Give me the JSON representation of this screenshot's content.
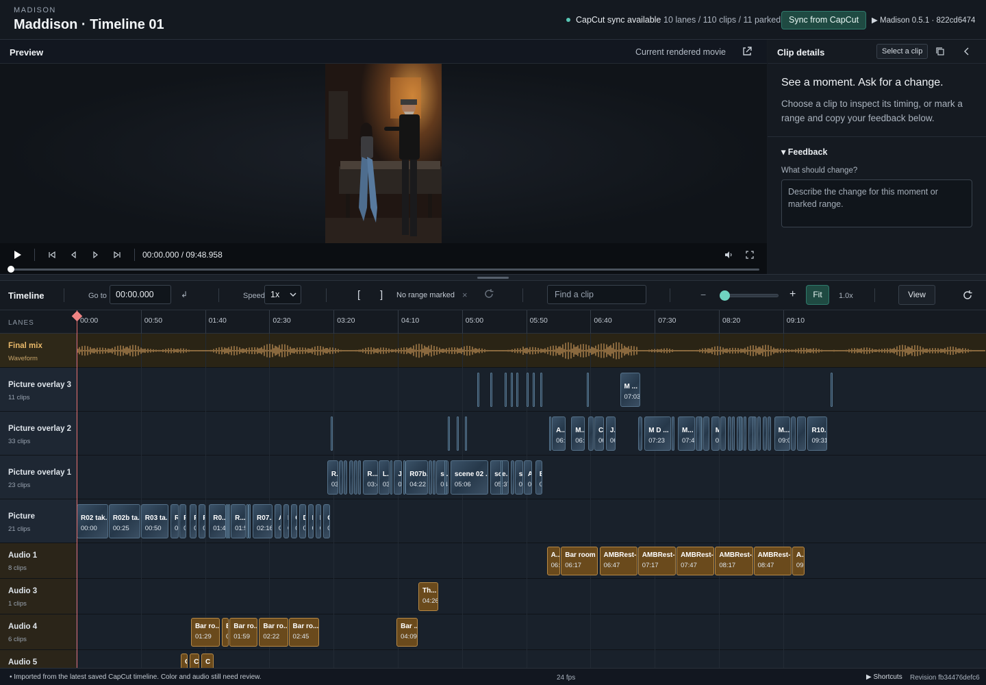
{
  "header": {
    "brand": "MADISON",
    "title": "Maddison · Timeline 01",
    "sync_status": "CapCut sync available",
    "counts": "10 lanes / 110 clips / 11 parked",
    "sync_button": "Sync from CapCut",
    "version": "▶ Madison 0.5.1 · 822cd6474",
    "accent_color": "#2f7a6c"
  },
  "preview": {
    "title": "Preview",
    "caption": "Current rendered movie",
    "icons": [
      "open-external-icon",
      "play-icon",
      "skip-start-icon",
      "frame-back-icon",
      "frame-forward-icon",
      "skip-end-icon",
      "volume-icon",
      "fullscreen-icon"
    ],
    "time": "00:00.000 / 09:48.958",
    "progress": 0
  },
  "details": {
    "title": "Clip details",
    "select_button": "Select a clip",
    "lead": "See a moment. Ask for a change.",
    "description": "Choose a clip to inspect its timing, or mark a range and copy your feedback below.",
    "feedback_toggle": "▾ Feedback",
    "feedback_question": "What should change?",
    "feedback_placeholder": "Describe the change for this moment or marked range."
  },
  "toolbar": {
    "title": "Timeline",
    "goto_label": "Go to",
    "goto_value": "00:00.000",
    "goto_enter": "↲",
    "speed_label": "Speed",
    "speed_value": "1x",
    "mark_in": "[",
    "mark_out": "]",
    "range_status": "No range marked",
    "clear": "×",
    "find_placeholder": "Find a clip",
    "zoom_out": "−",
    "zoom_in": "+",
    "zoom_slider": 0,
    "fit": "Fit",
    "zoom_level": "1.0x",
    "view": "View"
  },
  "ruler": {
    "lanes_label": "LANES",
    "ticks": [
      "00:00",
      "00:50",
      "01:40",
      "02:30",
      "03:20",
      "04:10",
      "05:00",
      "05:50",
      "06:40",
      "07:30",
      "08:20",
      "09:10"
    ]
  },
  "lanes": [
    {
      "name": "Final mix",
      "sub": "Waveform",
      "kind": "mix",
      "clips": []
    },
    {
      "name": "Picture overlay 3",
      "sub": "11 clips",
      "kind": "pic",
      "clips": [
        {
          "s": 312,
          "d": 1
        },
        {
          "s": 322,
          "d": 1
        },
        {
          "s": 333,
          "d": 1
        },
        {
          "s": 338,
          "d": 2
        },
        {
          "s": 342,
          "d": 1
        },
        {
          "s": 350,
          "d": 1
        },
        {
          "s": 355,
          "d": 1
        },
        {
          "s": 361,
          "d": 1
        },
        {
          "s": 397,
          "d": 2
        },
        {
          "name": "M ...",
          "time": "07:03",
          "s": 423,
          "d": 16
        },
        {
          "s": 587,
          "d": 1
        }
      ]
    },
    {
      "name": "Picture overlay 2",
      "sub": "33 clips",
      "kind": "pic",
      "clips": [
        {
          "s": 198,
          "d": 1
        },
        {
          "s": 289,
          "d": 1
        },
        {
          "s": 296,
          "d": 1
        },
        {
          "s": 302,
          "d": 2
        },
        {
          "s": 368,
          "d": 2
        },
        {
          "name": "A...",
          "time": "06:0",
          "s": 370,
          "d": 11
        },
        {
          "name": "M...",
          "time": "06:2",
          "s": 385,
          "d": 11
        },
        {
          "s": 398,
          "d": 5
        },
        {
          "name": "C...",
          "time": "06",
          "s": 403,
          "d": 8
        },
        {
          "name": "J...",
          "time": "06:",
          "s": 412,
          "d": 8
        },
        {
          "s": 437,
          "d": 4
        },
        {
          "name": "M D ...",
          "time": "07:23",
          "s": 442,
          "d": 21
        },
        {
          "s": 463,
          "d": 3
        },
        {
          "name": "M...",
          "time": "07:48",
          "s": 468,
          "d": 14
        },
        {
          "s": 482,
          "d": 6
        },
        {
          "s": 488,
          "d": 5
        },
        {
          "name": "M...",
          "time": "08",
          "s": 494,
          "d": 7
        },
        {
          "s": 501,
          "d": 5
        },
        {
          "s": 507,
          "d": 3
        },
        {
          "s": 510,
          "d": 3
        },
        {
          "s": 514,
          "d": 5
        },
        {
          "s": 519,
          "d": 3
        },
        {
          "s": 523,
          "d": 7
        },
        {
          "s": 530,
          "d": 3
        },
        {
          "s": 534,
          "d": 4
        },
        {
          "name": "M...",
          "time": "09:04",
          "s": 543,
          "d": 13
        },
        {
          "s": 556,
          "d": 4
        },
        {
          "s": 561,
          "d": 7
        },
        {
          "name": "R10...",
          "time": "09:31",
          "s": 569,
          "d": 16
        },
        {
          "s": 538,
          "d": 3
        },
        {
          "s": 526,
          "d": 3
        },
        {
          "s": 516,
          "d": 2
        },
        {
          "s": 485,
          "d": 2
        }
      ]
    },
    {
      "name": "Picture overlay 1",
      "sub": "23 clips",
      "kind": "pic",
      "clips": [
        {
          "name": "R...",
          "time": "03:",
          "s": 195,
          "d": 9
        },
        {
          "s": 204,
          "d": 4
        },
        {
          "s": 208,
          "d": 3
        },
        {
          "s": 212,
          "d": 4
        },
        {
          "s": 216,
          "d": 3
        },
        {
          "s": 219,
          "d": 3
        },
        {
          "name": "R...",
          "time": "03:45",
          "s": 223,
          "d": 12
        },
        {
          "name": "L...",
          "time": "03:5",
          "s": 235,
          "d": 9
        },
        {
          "s": 244,
          "d": 2
        },
        {
          "name": "J...",
          "time": "04",
          "s": 247,
          "d": 7
        },
        {
          "s": 254,
          "d": 2
        },
        {
          "name": "R07b...",
          "time": "04:22",
          "s": 256,
          "d": 18
        },
        {
          "s": 274,
          "d": 3
        },
        {
          "s": 277,
          "d": 3
        },
        {
          "name": "s...",
          "time": "04:50",
          "s": 280,
          "d": 10
        },
        {
          "name": "scene 02 ...",
          "time": "05:06",
          "s": 291,
          "d": 30
        },
        {
          "name": "sce...",
          "time": "05:37",
          "s": 322,
          "d": 15
        },
        {
          "s": 338,
          "d": 3
        },
        {
          "name": "s...",
          "time": "05:",
          "s": 341,
          "d": 7
        },
        {
          "name": "A...",
          "time": "06",
          "s": 348,
          "d": 7
        },
        {
          "name": "B...",
          "time": "06",
          "s": 357,
          "d": 6
        },
        {
          "s": 330,
          "d": 2
        },
        {
          "s": 286,
          "d": 2
        }
      ]
    },
    {
      "name": "Picture",
      "sub": "21 clips",
      "kind": "pic",
      "clips": [
        {
          "name": "R02 tak...",
          "time": "00:00",
          "s": 0,
          "d": 25
        },
        {
          "name": "R02b ta...",
          "time": "00:25",
          "s": 25,
          "d": 25
        },
        {
          "name": "R03 ta...",
          "time": "00:50",
          "s": 50,
          "d": 22
        },
        {
          "name": "R...",
          "time": "01",
          "s": 73,
          "d": 7
        },
        {
          "name": "R",
          "time": "01",
          "s": 80,
          "d": 6
        },
        {
          "name": "R",
          "time": "01",
          "s": 88,
          "d": 6
        },
        {
          "name": "R",
          "time": "01",
          "s": 95,
          "d": 6
        },
        {
          "name": "R0...",
          "time": "01:43",
          "s": 103,
          "d": 14
        },
        {
          "s": 118,
          "d": 2
        },
        {
          "name": "R...",
          "time": "01:59",
          "s": 120,
          "d": 12
        },
        {
          "s": 132,
          "d": 2
        },
        {
          "s": 134,
          "d": 2
        },
        {
          "name": "R07...",
          "time": "02:16",
          "s": 137,
          "d": 16
        },
        {
          "name": "A",
          "time": "0",
          "s": 154,
          "d": 6
        },
        {
          "name": "B",
          "time": "0",
          "s": 161,
          "d": 5
        },
        {
          "name": "C",
          "time": "0",
          "s": 167,
          "d": 5
        },
        {
          "name": "D",
          "time": "0",
          "s": 173,
          "d": 6
        },
        {
          "name": "E",
          "time": "0",
          "s": 180,
          "d": 5
        },
        {
          "name": "F",
          "time": "0",
          "s": 186,
          "d": 5
        },
        {
          "name": "G",
          "time": "0",
          "s": 192,
          "d": 6
        },
        {
          "s": 116,
          "d": 1
        }
      ]
    },
    {
      "name": "Audio 1",
      "sub": "8 clips",
      "kind": "aud",
      "clips": [
        {
          "name": "A...",
          "time": "06:0",
          "s": 366,
          "d": 11
        },
        {
          "name": "Bar room ...",
          "time": "06:17",
          "s": 377,
          "d": 29
        },
        {
          "name": "AMBRest-...",
          "time": "06:47",
          "s": 407,
          "d": 30
        },
        {
          "name": "AMBRest-...",
          "time": "07:17",
          "s": 437,
          "d": 30
        },
        {
          "name": "AMBRest-...",
          "time": "07:47",
          "s": 467,
          "d": 30
        },
        {
          "name": "AMBRest-...",
          "time": "08:17",
          "s": 497,
          "d": 30
        },
        {
          "name": "AMBRest-...",
          "time": "08:47",
          "s": 527,
          "d": 30
        },
        {
          "name": "A...",
          "time": "09:1",
          "s": 557,
          "d": 10
        }
      ]
    },
    {
      "name": "Audio 3",
      "sub": "1 clips",
      "kind": "aud",
      "clips": [
        {
          "name": "Th...",
          "time": "04:26",
          "s": 266,
          "d": 16
        }
      ]
    },
    {
      "name": "Audio 4",
      "sub": "6 clips",
      "kind": "aud",
      "clips": [
        {
          "name": "Bar ro...",
          "time": "01:29",
          "s": 89,
          "d": 23
        },
        {
          "name": "B...",
          "time": "01",
          "s": 113,
          "d": 6
        },
        {
          "name": "Bar ro...",
          "time": "01:59",
          "s": 119,
          "d": 22
        },
        {
          "name": "Bar ro...",
          "time": "02:22",
          "s": 142,
          "d": 23
        },
        {
          "name": "Bar ro...",
          "time": "02:45",
          "s": 165,
          "d": 24
        },
        {
          "name": "Bar ...",
          "time": "04:09",
          "s": 249,
          "d": 17
        }
      ]
    },
    {
      "name": "Audio 5",
      "sub": "",
      "kind": "aud",
      "clips": [
        {
          "name": "C",
          "time": "",
          "s": 81,
          "d": 6
        },
        {
          "name": "C",
          "time": "",
          "s": 88,
          "d": 8
        },
        {
          "name": "C",
          "time": "",
          "s": 97,
          "d": 10
        }
      ]
    }
  ],
  "footer": {
    "note": "•   Imported from the latest saved CapCut timeline. Color and audio still need review.",
    "fps": "24 fps",
    "shortcuts": "▶ Shortcuts",
    "revision": "Revision fb34476defc6"
  }
}
